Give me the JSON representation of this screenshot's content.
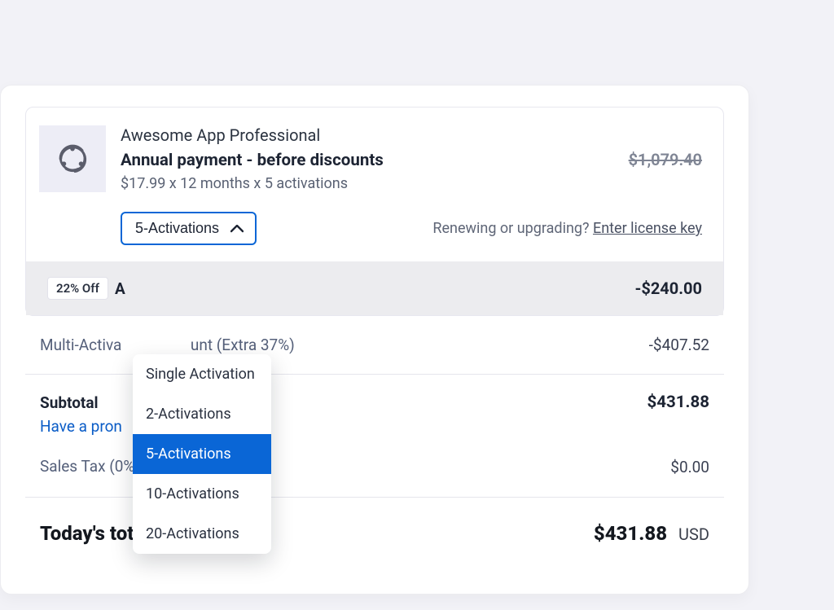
{
  "product": {
    "name": "Awesome App Professional",
    "payment_label": "Annual payment - before discounts",
    "breakdown": "$17.99 x 12 months x 5 activations",
    "original_price": "$1,079.40"
  },
  "activation_select": {
    "current": "5-Activations",
    "options": [
      "Single Activation",
      "2-Activations",
      "5-Activations",
      "10-Activations",
      "20-Activations"
    ],
    "selected_index": 2
  },
  "renew": {
    "text": "Renewing or upgrading? ",
    "link": "Enter license key"
  },
  "discounts": {
    "annual": {
      "badge": "22% Off",
      "label": "A",
      "amount": "-$240.00"
    },
    "multi": {
      "label": "Multi-Activa",
      "label_tail": "unt (Extra 37%)",
      "amount": "-$407.52"
    }
  },
  "subtotal": {
    "label": "Subtotal",
    "value": "$431.88"
  },
  "promo_link": "Have a pron",
  "tax": {
    "label": "Sales Tax (0%)",
    "value": "$0.00"
  },
  "total": {
    "label": "Today's total",
    "value": "$431.88",
    "currency": "USD"
  }
}
